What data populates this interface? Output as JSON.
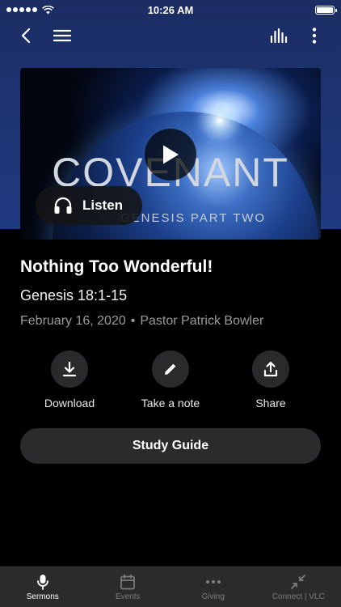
{
  "status_bar": {
    "time": "10:26 AM"
  },
  "nav": {
    "back": "back",
    "menu": "menu",
    "audio": "audio-levels",
    "more": "more"
  },
  "artwork": {
    "title": "COVENANT",
    "subtitle": "GENESIS PART TWO"
  },
  "player": {
    "listen_label": "Listen"
  },
  "sermon": {
    "title": "Nothing Too Wonderful!",
    "scripture": "Genesis 18:1-15",
    "date": "February 16, 2020",
    "separator": "•",
    "speaker": "Pastor Patrick Bowler"
  },
  "actions": [
    {
      "label": "Download",
      "icon": "download-icon"
    },
    {
      "label": "Take a note",
      "icon": "pencil-icon"
    },
    {
      "label": "Share",
      "icon": "share-icon"
    }
  ],
  "study_guide_label": "Study Guide",
  "tabs": [
    {
      "label": "Sermons",
      "icon": "microphone-icon",
      "active": true
    },
    {
      "label": "Events",
      "icon": "calendar-icon",
      "active": false
    },
    {
      "label": "Giving",
      "icon": "ellipsis-icon",
      "active": false
    },
    {
      "label": "Connect | VLC",
      "icon": "collapse-arrows-icon",
      "active": false
    }
  ],
  "colors": {
    "background": "#000000",
    "header": "#1e3575",
    "button": "#2b2b2d",
    "tab_bar": "#2b2b2b",
    "muted_text": "#9b9b9b"
  }
}
